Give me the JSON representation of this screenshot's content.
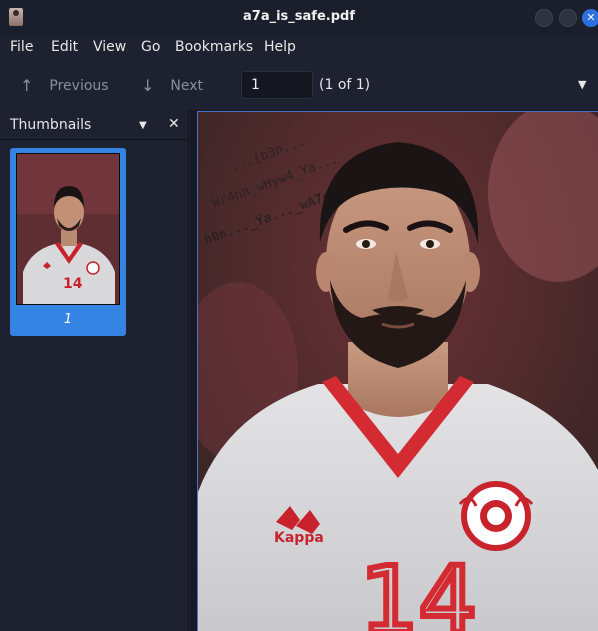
{
  "window": {
    "title": "a7a_is_safe.pdf"
  },
  "menu": {
    "items": [
      "File",
      "Edit",
      "View",
      "Go",
      "Bookmarks",
      "Help"
    ]
  },
  "toolbar": {
    "previous_label": "Previous",
    "next_label": "Next",
    "page_value": "1",
    "page_count": "(1 of 1)"
  },
  "sidebar": {
    "title": "Thumbnails",
    "thumbnails": [
      {
        "label": "1"
      }
    ]
  },
  "document": {
    "watermark_lines": [
      "...{b3n...",
      "Wr4nn_wHyw4_Ya...",
      "h0n..._Ya..._wA7ch} Securinet..."
    ],
    "jersey_number": "14",
    "jersey_brand": "Kappa"
  }
}
